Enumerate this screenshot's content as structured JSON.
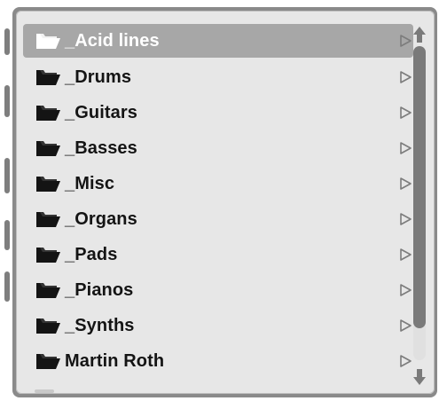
{
  "browser": {
    "items": [
      {
        "label": "_Acid lines",
        "selected": true,
        "icon": "folder-icon",
        "expand_icon": "play-triangle-icon"
      },
      {
        "label": "_Drums",
        "selected": false,
        "icon": "folder-icon",
        "expand_icon": "play-triangle-icon"
      },
      {
        "label": "_Guitars",
        "selected": false,
        "icon": "folder-icon",
        "expand_icon": "play-triangle-icon"
      },
      {
        "label": "_Basses",
        "selected": false,
        "icon": "folder-icon",
        "expand_icon": "play-triangle-icon"
      },
      {
        "label": "_Misc",
        "selected": false,
        "icon": "folder-icon",
        "expand_icon": "play-triangle-icon"
      },
      {
        "label": "_Organs",
        "selected": false,
        "icon": "folder-icon",
        "expand_icon": "play-triangle-icon"
      },
      {
        "label": "_Pads",
        "selected": false,
        "icon": "folder-icon",
        "expand_icon": "play-triangle-icon"
      },
      {
        "label": "_Pianos",
        "selected": false,
        "icon": "folder-icon",
        "expand_icon": "play-triangle-icon"
      },
      {
        "label": "_Synths",
        "selected": false,
        "icon": "folder-icon",
        "expand_icon": "play-triangle-icon"
      },
      {
        "label": "Martin Roth",
        "selected": false,
        "icon": "folder-icon",
        "expand_icon": "play-triangle-icon"
      }
    ],
    "scrollbar": {
      "up_icon": "arrow-up-icon",
      "down_icon": "arrow-down-icon",
      "position": 0.0
    }
  },
  "colors": {
    "selected_bg": "#a7a7a7",
    "panel_bg": "#e7e7e7",
    "frame": "#8a8a8a",
    "text": "#141414",
    "selected_text": "#ffffff",
    "thumb": "#7a7a7a"
  }
}
